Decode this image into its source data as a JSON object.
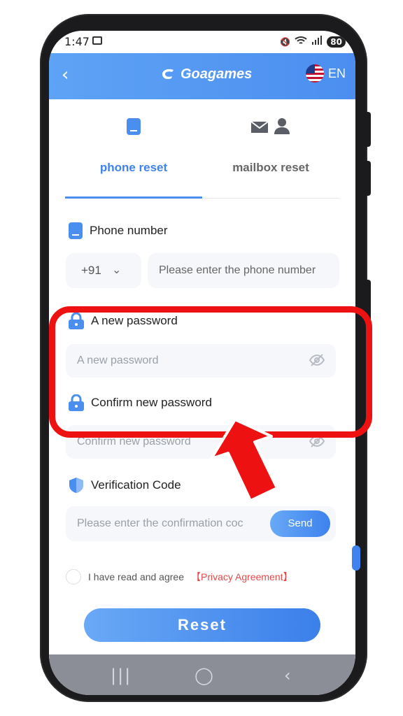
{
  "status_bar": {
    "time": "1:47",
    "battery": "80"
  },
  "header": {
    "back_icon": "chevron-left-icon",
    "brand": "Goagames",
    "language": "EN",
    "accent": "#4b8ef0"
  },
  "tabs": [
    {
      "label": "phone reset",
      "icon": "phone-icon",
      "active": true
    },
    {
      "label": "mailbox reset",
      "icon": "mail-user-icon",
      "active": false
    }
  ],
  "form": {
    "phone": {
      "title": "Phone number",
      "country_code": "+91",
      "placeholder": "Please enter the phone number"
    },
    "new_password": {
      "title": "A new password",
      "placeholder": "A new password"
    },
    "confirm_password": {
      "title": "Confirm new password",
      "placeholder": "Confirm new password"
    },
    "verification": {
      "title": "Verification Code",
      "placeholder": "Please enter the confirmation coc",
      "send_label": "Send"
    },
    "agreement": {
      "text": "I have read and agree",
      "link": "【Privacy Agreement】"
    },
    "reset_label": "Reset"
  },
  "annotation": {
    "color": "#ee1111"
  }
}
